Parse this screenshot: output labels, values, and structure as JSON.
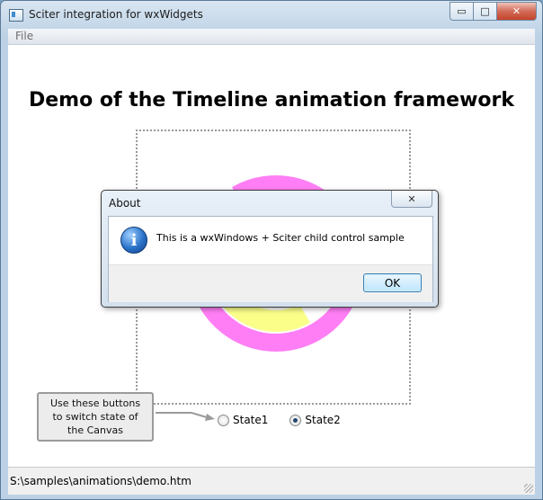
{
  "window": {
    "title": "Sciter integration for wxWidgets",
    "icon": "app-icon",
    "caption_buttons": {
      "minimize": "▭",
      "maximize": "□",
      "close": "✕"
    }
  },
  "menubar": {
    "file": "File"
  },
  "content": {
    "heading": "Demo of the Timeline animation framework",
    "callout": "Use these buttons to switch state of the Canvas",
    "radios": [
      {
        "label": "State1",
        "checked": false
      },
      {
        "label": "State2",
        "checked": true
      }
    ],
    "colors": {
      "magenta_ring": "#ff7ef5",
      "yellow_ring": "#fbff8a",
      "red_disc": "#f06a6a"
    }
  },
  "statusbar": {
    "path": "S:\\samples\\animations\\demo.htm"
  },
  "dialog": {
    "title": "About",
    "close_glyph": "✕",
    "icon": "info-icon",
    "icon_glyph": "i",
    "message": "This is a wxWindows + Sciter child control sample",
    "ok_label": "OK"
  }
}
